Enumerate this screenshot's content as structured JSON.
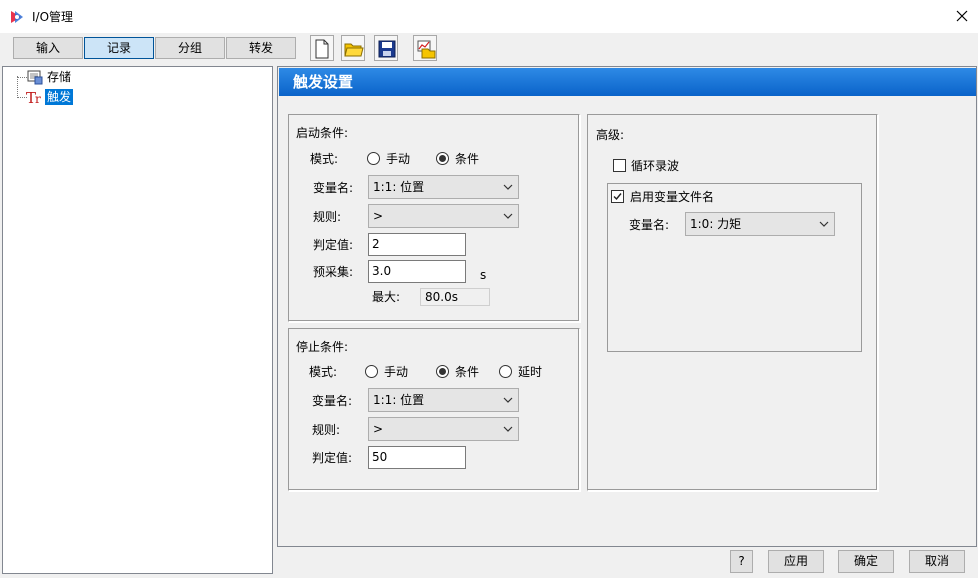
{
  "window": {
    "title": "I/O管理",
    "close_label": "✕"
  },
  "tabs": [
    {
      "label": "输入"
    },
    {
      "label": "记录"
    },
    {
      "label": "分组"
    },
    {
      "label": "转发"
    }
  ],
  "tree": {
    "items": [
      {
        "label": "存储"
      },
      {
        "label": "触发"
      }
    ]
  },
  "section": {
    "title": "触发设置"
  },
  "start": {
    "title": "启动条件:",
    "mode_label": "模式:",
    "mode_options": [
      "手动",
      "条件"
    ],
    "mode_selected": "条件",
    "var_label": "变量名:",
    "var_value": "1:1: 位置",
    "rule_label": "规则:",
    "rule_value": ">",
    "threshold_label": "判定值:",
    "threshold_value": "2",
    "precollect_label": "预采集:",
    "precollect_value": "3.0",
    "precollect_unit": "s",
    "max_label": "最大:",
    "max_value": "80.0s"
  },
  "stop": {
    "title": "停止条件:",
    "mode_label": "模式:",
    "mode_options": [
      "手动",
      "条件",
      "延时"
    ],
    "mode_selected": "条件",
    "var_label": "变量名:",
    "var_value": "1:1: 位置",
    "rule_label": "规则:",
    "rule_value": ">",
    "threshold_label": "判定值:",
    "threshold_value": "50"
  },
  "advanced": {
    "title": "高级:",
    "loop_label": "循环录波",
    "loop_checked": false,
    "varfile_label": "启用变量文件名",
    "varfile_checked": true,
    "var_label": "变量名:",
    "var_value": "1:0: 力矩"
  },
  "buttons": {
    "help": "?",
    "apply": "应用",
    "ok": "确定",
    "cancel": "取消"
  }
}
